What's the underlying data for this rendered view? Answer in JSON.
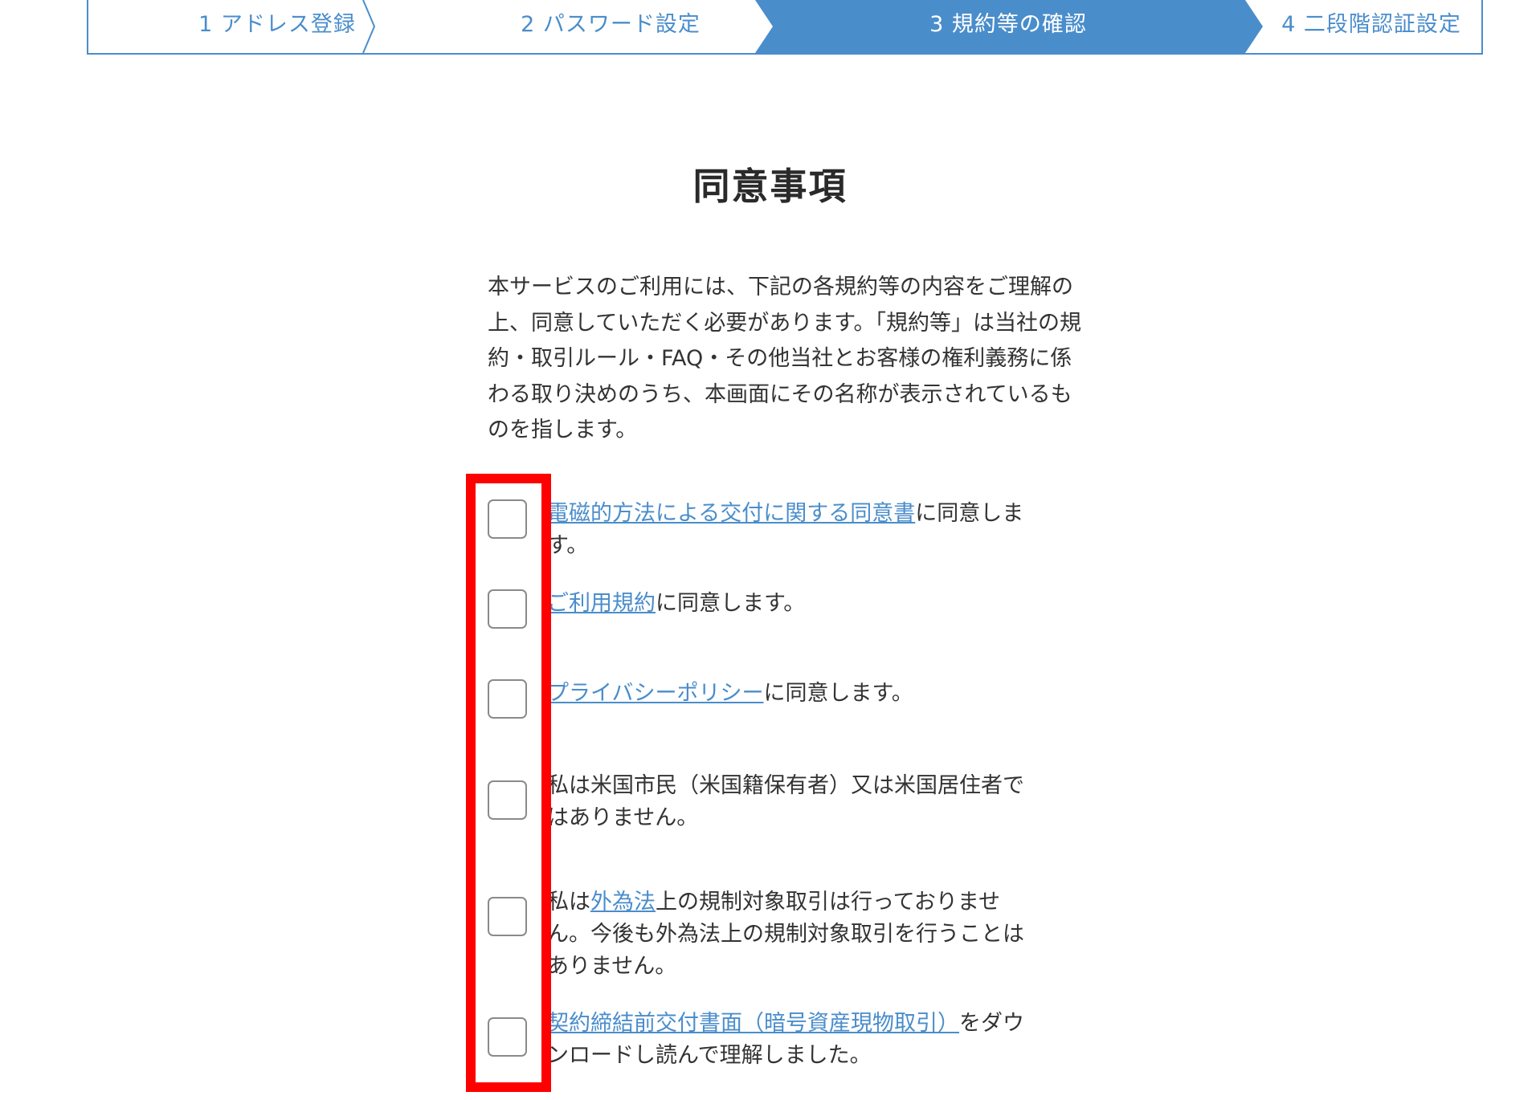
{
  "stepper": {
    "steps": [
      {
        "label": "1 アドレス登録",
        "active": false
      },
      {
        "label": "2 パスワード設定",
        "active": false
      },
      {
        "label": "3 規約等の確認",
        "active": true
      },
      {
        "label": "4 二段階認証設定",
        "active": false
      }
    ]
  },
  "title": "同意事項",
  "intro": "本サービスのご利用には、下記の各規約等の内容をご理解の上、同意していただく必要があります。「規約等」は当社の規約・取引ルール・FAQ・その他当社とお客様の権利義務に係わる取り決めのうち、本画面にその名称が表示されているものを指します。",
  "agreements": [
    {
      "link": "電磁的方法による交付に関する同意書",
      "suffix": "に同意します。",
      "checked": false
    },
    {
      "link": "ご利用規約",
      "suffix": "に同意します。",
      "checked": false
    },
    {
      "link": "プライバシーポリシー",
      "suffix": "に同意します。",
      "checked": false
    },
    {
      "text": "私は米国市民（米国籍保有者）又は米国居住者ではありません。",
      "checked": false
    },
    {
      "prefix": "私は",
      "link": "外為法",
      "suffix": "上の規制対象取引は行っておりません。今後も外為法上の規制対象取引を行うことはありません。",
      "checked": false
    },
    {
      "link": "契約締結前交付書面（暗号資産現物取引）",
      "suffix": "をダウンロードし読んで理解しました。",
      "checked": false
    }
  ],
  "colors": {
    "accent": "#4a8dcb",
    "highlight": "#ff0000",
    "text": "#333333"
  }
}
